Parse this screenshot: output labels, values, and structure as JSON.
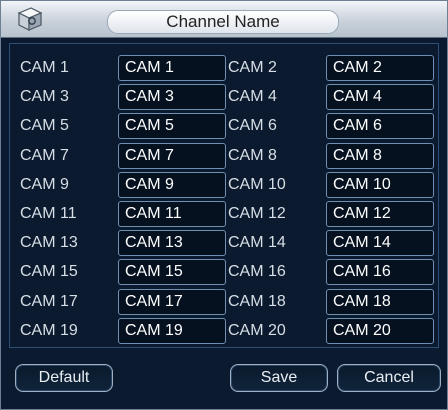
{
  "window": {
    "title": "Channel Name"
  },
  "channels": [
    {
      "label": "CAM 1",
      "value": "CAM 1"
    },
    {
      "label": "CAM 2",
      "value": "CAM 2"
    },
    {
      "label": "CAM 3",
      "value": "CAM 3"
    },
    {
      "label": "CAM 4",
      "value": "CAM 4"
    },
    {
      "label": "CAM 5",
      "value": "CAM 5"
    },
    {
      "label": "CAM 6",
      "value": "CAM 6"
    },
    {
      "label": "CAM 7",
      "value": "CAM 7"
    },
    {
      "label": "CAM 8",
      "value": "CAM 8"
    },
    {
      "label": "CAM 9",
      "value": "CAM 9"
    },
    {
      "label": "CAM 10",
      "value": "CAM 10"
    },
    {
      "label": "CAM 11",
      "value": "CAM 11"
    },
    {
      "label": "CAM 12",
      "value": "CAM 12"
    },
    {
      "label": "CAM 13",
      "value": "CAM 13"
    },
    {
      "label": "CAM 14",
      "value": "CAM 14"
    },
    {
      "label": "CAM 15",
      "value": "CAM 15"
    },
    {
      "label": "CAM 16",
      "value": "CAM 16"
    },
    {
      "label": "CAM 17",
      "value": "CAM 17"
    },
    {
      "label": "CAM 18",
      "value": "CAM 18"
    },
    {
      "label": "CAM 19",
      "value": "CAM 19"
    },
    {
      "label": "CAM 20",
      "value": "CAM 20"
    }
  ],
  "buttons": {
    "default_label": "Default",
    "save_label": "Save",
    "cancel_label": "Cancel"
  },
  "icons": {
    "title_icon": "gear-cube-icon"
  },
  "colors": {
    "background": "#0b1a2e",
    "field_border": "#6f8fb3",
    "label_text": "#d7dee6"
  }
}
